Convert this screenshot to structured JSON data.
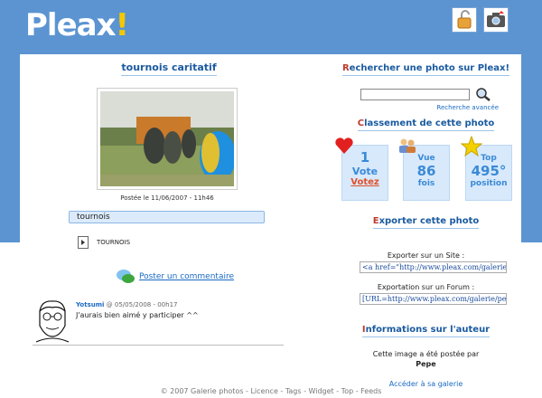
{
  "header": {
    "logo_text": "Pleax",
    "logo_bang": "!",
    "login_icon": "padlock-icon",
    "upload_icon": "camera-icon"
  },
  "photo": {
    "title": "tournois caritatif",
    "date": "Postée le 11/06/2007 - 11h46",
    "tag_field_value": "tournois",
    "tags": [
      "TOURNOIS"
    ],
    "post_comment_label": "Poster un commentaire"
  },
  "comments": [
    {
      "author": "Yotsumi",
      "datetime": "@ 05/05/2008 - 00h17",
      "text": "J'aurais bien aimé y participer ^^"
    }
  ],
  "sidebar": {
    "search_title_first": "R",
    "search_title_rest": "echercher une photo sur Pleax!",
    "search_placeholder": "",
    "advanced_search": "Recherche avancée",
    "ranking_title_first": "C",
    "ranking_title_rest": "lassement de cette photo",
    "cards": [
      {
        "top": "1",
        "mid": "Vote",
        "bottom": "Votez",
        "icon": "heart-icon"
      },
      {
        "top": "Vue",
        "mid": "86",
        "bottom": "fois",
        "icon": "people-icon"
      },
      {
        "top": "Top",
        "mid": "495°",
        "bottom": "position",
        "icon": "star-icon"
      }
    ],
    "export_title_first": "E",
    "export_title_rest": "xporter cette photo",
    "export_site_label": "Exporter sur un Site :",
    "export_site_code": "<a href=\"http://www.pleax.com/galerie/pe",
    "export_forum_label": "Exportation sur un Forum :",
    "export_forum_code": "[URL=http://www.pleax.com/galerie/pepe,",
    "author_title_first": "I",
    "author_title_rest": "nformations sur l'auteur",
    "author_posted_by": "Cette image a été postée par",
    "author_name": "Pepe",
    "author_gallery_link": "Accéder à sa galerie"
  },
  "footer": {
    "text": "© 2007 Galerie photos - Licence - Tags - Widget - Top - Feeds"
  },
  "colors": {
    "header_bg": "#5b94d1",
    "accent_blue": "#1a5aa0",
    "accent_red": "#c0392b",
    "card_bg": "#d7e9fb"
  }
}
